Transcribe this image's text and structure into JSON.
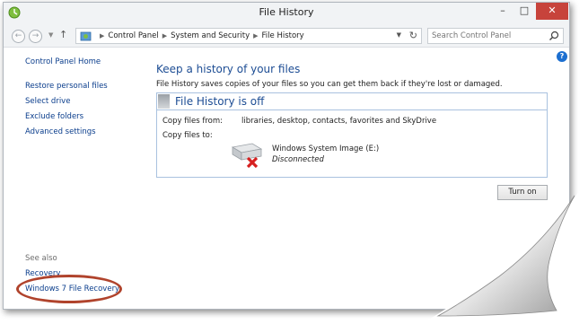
{
  "window": {
    "title": "File History"
  },
  "controls": {
    "minimize": "–",
    "maximize": "□",
    "close": "✕"
  },
  "address": {
    "breadcrumbs": [
      "Control Panel",
      "System and Security",
      "File History"
    ],
    "search_placeholder": "Search Control Panel"
  },
  "sidebar": {
    "home": "Control Panel Home",
    "links": [
      "Restore personal files",
      "Select drive",
      "Exclude folders",
      "Advanced settings"
    ],
    "see_also_label": "See also",
    "see_also": [
      "Recovery",
      "Windows 7 File Recovery"
    ]
  },
  "main": {
    "heading": "Keep a history of your files",
    "description": "File History saves copies of your files so you can get them back if they're lost or damaged.",
    "status_title": "File History is off",
    "copy_from_label": "Copy files from:",
    "copy_from_value": "libraries, desktop, contacts, favorites and SkyDrive",
    "copy_to_label": "Copy files to:",
    "drive_name": "Windows System Image (E:)",
    "drive_status": "Disconnected",
    "turn_on": "Turn on"
  },
  "colors": {
    "link": "#0a3d8c",
    "heading": "#1d4d94",
    "close_button": "#c7433b",
    "highlight_ellipse": "#b0432c"
  }
}
